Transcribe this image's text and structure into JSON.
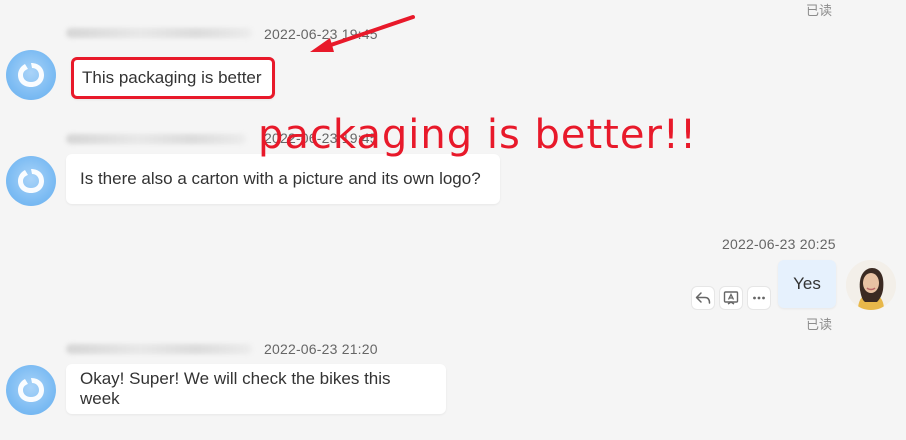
{
  "top_read_status": "已读",
  "messages": [
    {
      "author": "",
      "timestamp": "2022-06-23 19:45",
      "text": "This packaging is better"
    },
    {
      "author": "",
      "timestamp": "2022-06-23 19:45",
      "text": "Is there also a carton with a picture and its own logo?"
    },
    {
      "author": "",
      "timestamp": "2022-06-23 20:25",
      "text": "Yes",
      "read_status": "已读"
    },
    {
      "author": "",
      "timestamp": "2022-06-23 21:20",
      "text": "Okay! Super! We will check the bikes this week"
    }
  ],
  "annotation": {
    "text": "packaging is better!!",
    "color": "#e8192a"
  },
  "actions": {
    "icons": [
      "reply-icon",
      "translate-icon",
      "more-icon"
    ]
  },
  "colors": {
    "bubble_other": "#ffffff",
    "bubble_self": "#e6f1fd",
    "background": "#f5f5f5",
    "avatar_blue": "#7dbcf3"
  }
}
